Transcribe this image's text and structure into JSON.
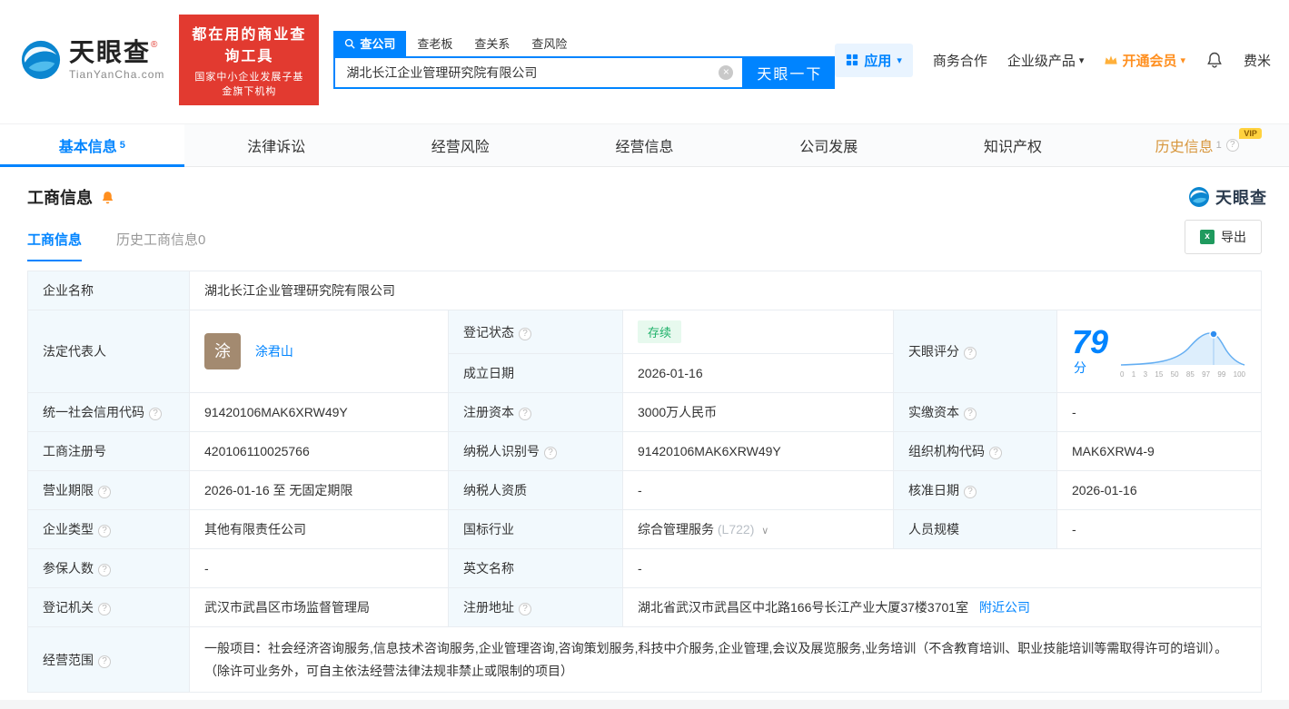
{
  "brand": {
    "name": "天眼查",
    "reg_mark": "®",
    "domain": "TianYanCha.com",
    "banner_line1": "都在用的商业查询工具",
    "banner_line2": "国家中小企业发展子基金旗下机构"
  },
  "search": {
    "tabs": [
      "查公司",
      "查老板",
      "查关系",
      "查风险"
    ],
    "value": "湖北长江企业管理研究院有限公司",
    "button": "天眼一下"
  },
  "topnav": {
    "apps": "应用",
    "business_coop": "商务合作",
    "enterprise_products": "企业级产品",
    "vip": "开通会员",
    "username": "费米"
  },
  "tabs": {
    "basic": "基本信息",
    "basic_count": "5",
    "legal": "法律诉讼",
    "risk": "经营风险",
    "operation": "经营信息",
    "development": "公司发展",
    "ip": "知识产权",
    "history": "历史信息",
    "history_count": "1",
    "history_vip": "VIP"
  },
  "section": {
    "title": "工商信息",
    "subtab_active": "工商信息",
    "subtab_history": "历史工商信息0",
    "export": "导出",
    "watermark": "天眼查"
  },
  "fields": {
    "company_name_label": "企业名称",
    "company_name": "湖北长江企业管理研究院有限公司",
    "legal_rep_label": "法定代表人",
    "legal_rep_avatar": "涂",
    "legal_rep_name": "涂君山",
    "reg_status_label": "登记状态",
    "reg_status": "存续",
    "establish_date_label": "成立日期",
    "establish_date": "2026-01-16",
    "score_label": "天眼评分",
    "credit_code_label": "统一社会信用代码",
    "credit_code": "91420106MAK6XRW49Y",
    "reg_capital_label": "注册资本",
    "reg_capital": "3000万人民币",
    "paidin_capital_label": "实缴资本",
    "paidin_capital": "-",
    "reg_no_label": "工商注册号",
    "reg_no": "420106110025766",
    "taxpayer_id_label": "纳税人识别号",
    "taxpayer_id": "91420106MAK6XRW49Y",
    "org_code_label": "组织机构代码",
    "org_code": "MAK6XRW4-9",
    "term_label": "营业期限",
    "term": "2026-01-16 至 无固定期限",
    "taxpayer_quality_label": "纳税人资质",
    "taxpayer_quality": "-",
    "approve_date_label": "核准日期",
    "approve_date": "2026-01-16",
    "company_type_label": "企业类型",
    "company_type": "其他有限责任公司",
    "industry_label": "国标行业",
    "industry": "综合管理服务",
    "industry_code": "(L722)",
    "staff_label": "人员规模",
    "staff": "-",
    "insured_label": "参保人数",
    "insured": "-",
    "en_name_label": "英文名称",
    "en_name": "-",
    "authority_label": "登记机关",
    "authority": "武汉市武昌区市场监督管理局",
    "address_label": "注册地址",
    "address": "湖北省武汉市武昌区中北路166号长江产业大厦37楼3701室",
    "nearby": "附近公司",
    "scope_label": "经营范围",
    "scope": "一般项目：社会经济咨询服务,信息技术咨询服务,企业管理咨询,咨询策划服务,科技中介服务,企业管理,会议及展览服务,业务培训（不含教育培训、职业技能培训等需取得许可的培训）。 （除许可业务外，可自主依法经营法律法规非禁止或限制的项目）"
  },
  "score": {
    "value": "79",
    "unit": "分",
    "axis": [
      "0",
      "1",
      "3",
      "15",
      "50",
      "85",
      "97",
      "99",
      "100"
    ]
  },
  "colors": {
    "accent_blue": "#0084ff",
    "banner_red": "#e23a30",
    "status_green": "#1fb16a",
    "vip_orange": "#ff8f1f",
    "label_bg": "#f2f9fd"
  }
}
